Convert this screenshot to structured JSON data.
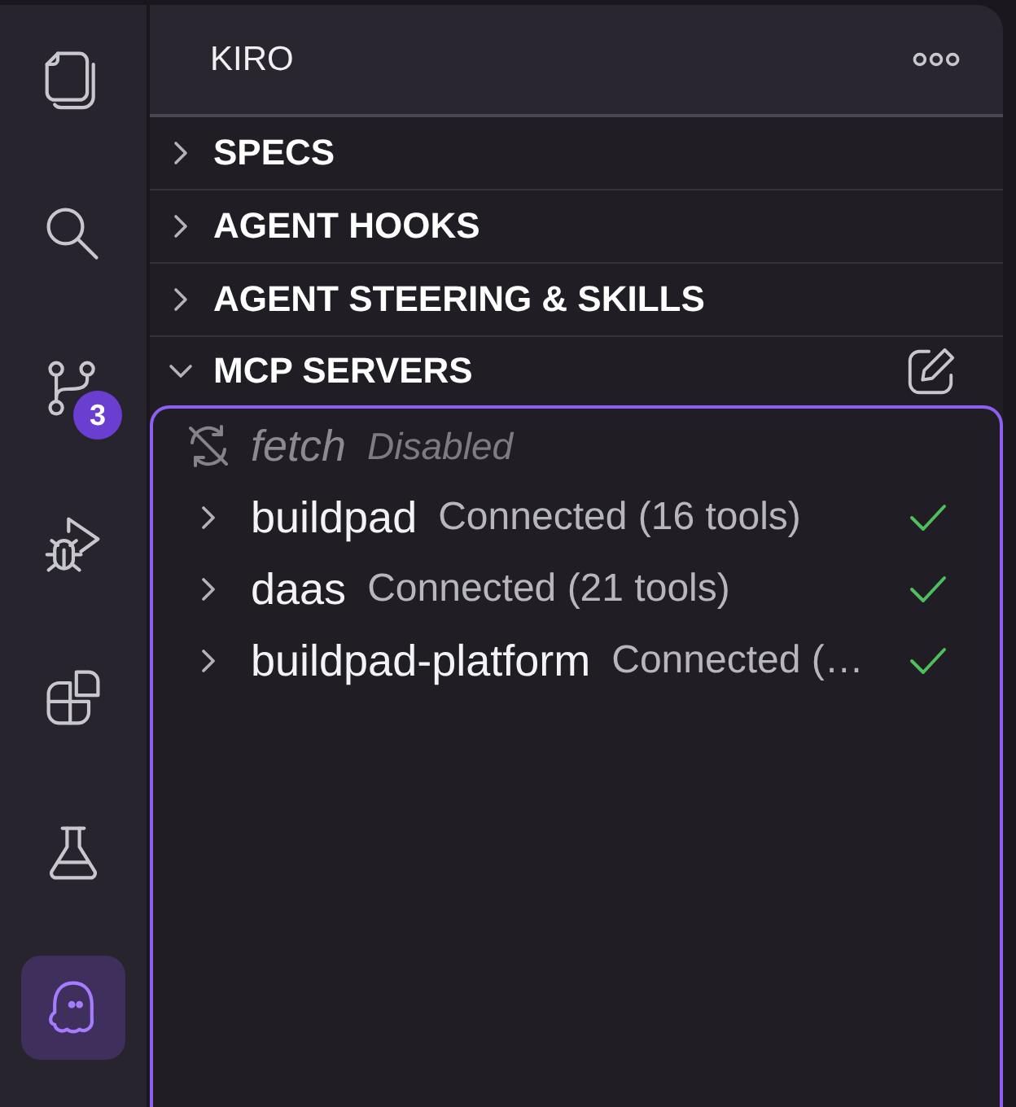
{
  "activity_bar": {
    "items": [
      {
        "selected": false
      },
      {
        "selected": false
      },
      {
        "selected": false,
        "badge": "3"
      },
      {
        "selected": false
      },
      {
        "selected": false
      },
      {
        "selected": false
      },
      {
        "selected": true
      }
    ]
  },
  "panel": {
    "title": "KIRO"
  },
  "sections": [
    {
      "label": "SPECS",
      "expanded": false
    },
    {
      "label": "AGENT HOOKS",
      "expanded": false
    },
    {
      "label": "AGENT STEERING & SKILLS",
      "expanded": false
    },
    {
      "label": "MCP SERVERS",
      "expanded": true,
      "focused": true,
      "servers": [
        {
          "name": "fetch",
          "status": "Disabled",
          "kind": "disabled"
        },
        {
          "name": "buildpad",
          "status": "Connected (16 tools)",
          "kind": "connected",
          "expanded": false
        },
        {
          "name": "daas",
          "status": "Connected (21 tools)",
          "kind": "connected",
          "expanded": false
        },
        {
          "name": "buildpad-platform",
          "status": "Connected (…",
          "kind": "connected",
          "expanded": false
        }
      ]
    }
  ]
}
